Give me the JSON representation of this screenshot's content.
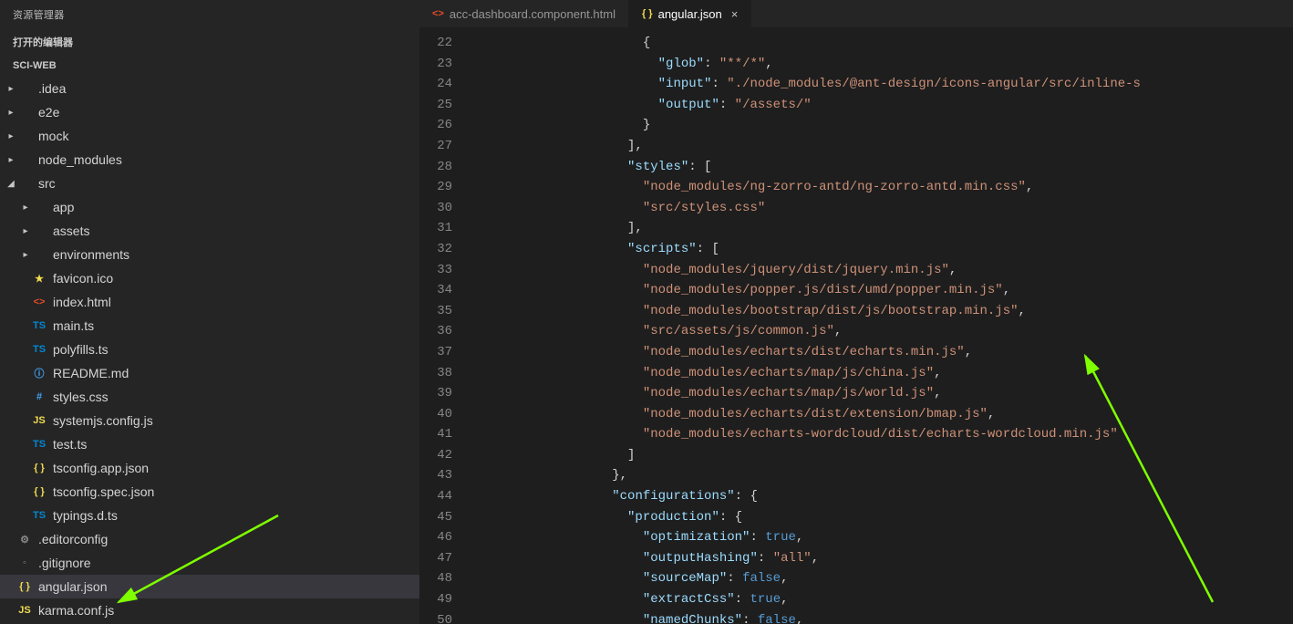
{
  "sidebar": {
    "title": "资源管理器",
    "open_editors": "打开的编辑器",
    "project": "SCI-WEB",
    "items": [
      {
        "label": ".idea",
        "kind": "folder",
        "expanded": false,
        "depth": 0
      },
      {
        "label": "e2e",
        "kind": "folder",
        "expanded": false,
        "depth": 0
      },
      {
        "label": "mock",
        "kind": "folder",
        "expanded": false,
        "depth": 0
      },
      {
        "label": "node_modules",
        "kind": "folder",
        "expanded": false,
        "depth": 0
      },
      {
        "label": "src",
        "kind": "folder",
        "expanded": true,
        "depth": 0
      },
      {
        "label": "app",
        "kind": "folder",
        "expanded": false,
        "depth": 1
      },
      {
        "label": "assets",
        "kind": "folder",
        "expanded": false,
        "depth": 1
      },
      {
        "label": "environments",
        "kind": "folder",
        "expanded": false,
        "depth": 1
      },
      {
        "label": "favicon.ico",
        "kind": "star",
        "depth": 1
      },
      {
        "label": "index.html",
        "kind": "html",
        "depth": 1
      },
      {
        "label": "main.ts",
        "kind": "ts",
        "depth": 1
      },
      {
        "label": "polyfills.ts",
        "kind": "ts",
        "depth": 1
      },
      {
        "label": "README.md",
        "kind": "md",
        "depth": 1
      },
      {
        "label": "styles.css",
        "kind": "css",
        "depth": 1
      },
      {
        "label": "systemjs.config.js",
        "kind": "js",
        "depth": 1
      },
      {
        "label": "test.ts",
        "kind": "ts",
        "depth": 1
      },
      {
        "label": "tsconfig.app.json",
        "kind": "json",
        "depth": 1
      },
      {
        "label": "tsconfig.spec.json",
        "kind": "json",
        "depth": 1
      },
      {
        "label": "typings.d.ts",
        "kind": "ts",
        "depth": 1
      },
      {
        "label": ".editorconfig",
        "kind": "gear",
        "depth": 0
      },
      {
        "label": ".gitignore",
        "kind": "dot",
        "depth": 0
      },
      {
        "label": "angular.json",
        "kind": "json",
        "depth": 0,
        "active": true
      },
      {
        "label": "karma.conf.js",
        "kind": "js",
        "depth": 0
      }
    ]
  },
  "tabs": [
    {
      "label": "acc-dashboard.component.html",
      "icon": "html",
      "active": false
    },
    {
      "label": "angular.json",
      "icon": "json",
      "active": true
    }
  ],
  "editor": {
    "first_line": 22,
    "lines": [
      [
        {
          "t": "punc",
          "v": "              {"
        }
      ],
      [
        {
          "t": "punc",
          "v": "                "
        },
        {
          "t": "key",
          "v": "\"glob\""
        },
        {
          "t": "punc",
          "v": ": "
        },
        {
          "t": "str",
          "v": "\"**/*\""
        },
        {
          "t": "punc",
          "v": ","
        }
      ],
      [
        {
          "t": "punc",
          "v": "                "
        },
        {
          "t": "key",
          "v": "\"input\""
        },
        {
          "t": "punc",
          "v": ": "
        },
        {
          "t": "str",
          "v": "\"./node_modules/@ant-design/icons-angular/src/inline-s"
        }
      ],
      [
        {
          "t": "punc",
          "v": "                "
        },
        {
          "t": "key",
          "v": "\"output\""
        },
        {
          "t": "punc",
          "v": ": "
        },
        {
          "t": "str",
          "v": "\"/assets/\""
        }
      ],
      [
        {
          "t": "punc",
          "v": "              }"
        }
      ],
      [
        {
          "t": "punc",
          "v": "            ],"
        }
      ],
      [
        {
          "t": "punc",
          "v": "            "
        },
        {
          "t": "key",
          "v": "\"styles\""
        },
        {
          "t": "punc",
          "v": ": ["
        }
      ],
      [
        {
          "t": "punc",
          "v": "              "
        },
        {
          "t": "str",
          "v": "\"node_modules/ng-zorro-antd/ng-zorro-antd.min.css\""
        },
        {
          "t": "punc",
          "v": ","
        }
      ],
      [
        {
          "t": "punc",
          "v": "              "
        },
        {
          "t": "str",
          "v": "\"src/styles.css\""
        }
      ],
      [
        {
          "t": "punc",
          "v": "            ],"
        }
      ],
      [
        {
          "t": "punc",
          "v": "            "
        },
        {
          "t": "key",
          "v": "\"scripts\""
        },
        {
          "t": "punc",
          "v": ": ["
        }
      ],
      [
        {
          "t": "punc",
          "v": "              "
        },
        {
          "t": "str",
          "v": "\"node_modules/jquery/dist/jquery.min.js\""
        },
        {
          "t": "punc",
          "v": ","
        }
      ],
      [
        {
          "t": "punc",
          "v": "              "
        },
        {
          "t": "str",
          "v": "\"node_modules/popper.js/dist/umd/popper.min.js\""
        },
        {
          "t": "punc",
          "v": ","
        }
      ],
      [
        {
          "t": "punc",
          "v": "              "
        },
        {
          "t": "str",
          "v": "\"node_modules/bootstrap/dist/js/bootstrap.min.js\""
        },
        {
          "t": "punc",
          "v": ","
        }
      ],
      [
        {
          "t": "punc",
          "v": "              "
        },
        {
          "t": "str",
          "v": "\"src/assets/js/common.js\""
        },
        {
          "t": "punc",
          "v": ","
        }
      ],
      [
        {
          "t": "punc",
          "v": "              "
        },
        {
          "t": "str",
          "v": "\"node_modules/echarts/dist/echarts.min.js\""
        },
        {
          "t": "punc",
          "v": ","
        }
      ],
      [
        {
          "t": "punc",
          "v": "              "
        },
        {
          "t": "str",
          "v": "\"node_modules/echarts/map/js/china.js\""
        },
        {
          "t": "punc",
          "v": ","
        }
      ],
      [
        {
          "t": "punc",
          "v": "              "
        },
        {
          "t": "str",
          "v": "\"node_modules/echarts/map/js/world.js\""
        },
        {
          "t": "punc",
          "v": ","
        }
      ],
      [
        {
          "t": "punc",
          "v": "              "
        },
        {
          "t": "str",
          "v": "\"node_modules/echarts/dist/extension/bmap.js\""
        },
        {
          "t": "punc",
          "v": ","
        }
      ],
      [
        {
          "t": "punc",
          "v": "              "
        },
        {
          "t": "str",
          "v": "\"node_modules/echarts-wordcloud/dist/echarts-wordcloud.min.js\""
        }
      ],
      [
        {
          "t": "punc",
          "v": "            ]"
        }
      ],
      [
        {
          "t": "punc",
          "v": "          },"
        }
      ],
      [
        {
          "t": "punc",
          "v": "          "
        },
        {
          "t": "key",
          "v": "\"configurations\""
        },
        {
          "t": "punc",
          "v": ": {"
        }
      ],
      [
        {
          "t": "punc",
          "v": "            "
        },
        {
          "t": "key",
          "v": "\"production\""
        },
        {
          "t": "punc",
          "v": ": {"
        }
      ],
      [
        {
          "t": "punc",
          "v": "              "
        },
        {
          "t": "key",
          "v": "\"optimization\""
        },
        {
          "t": "punc",
          "v": ": "
        },
        {
          "t": "const",
          "v": "true"
        },
        {
          "t": "punc",
          "v": ","
        }
      ],
      [
        {
          "t": "punc",
          "v": "              "
        },
        {
          "t": "key",
          "v": "\"outputHashing\""
        },
        {
          "t": "punc",
          "v": ": "
        },
        {
          "t": "str",
          "v": "\"all\""
        },
        {
          "t": "punc",
          "v": ","
        }
      ],
      [
        {
          "t": "punc",
          "v": "              "
        },
        {
          "t": "key",
          "v": "\"sourceMap\""
        },
        {
          "t": "punc",
          "v": ": "
        },
        {
          "t": "const",
          "v": "false"
        },
        {
          "t": "punc",
          "v": ","
        }
      ],
      [
        {
          "t": "punc",
          "v": "              "
        },
        {
          "t": "key",
          "v": "\"extractCss\""
        },
        {
          "t": "punc",
          "v": ": "
        },
        {
          "t": "const",
          "v": "true"
        },
        {
          "t": "punc",
          "v": ","
        }
      ],
      [
        {
          "t": "punc",
          "v": "              "
        },
        {
          "t": "key",
          "v": "\"namedChunks\""
        },
        {
          "t": "punc",
          "v": ": "
        },
        {
          "t": "const",
          "v": "false"
        },
        {
          "t": "punc",
          "v": ","
        }
      ]
    ]
  },
  "icons": {
    "folder": "",
    "ts": "TS",
    "js": "JS",
    "json": "{ }",
    "html": "<>",
    "css": "#",
    "md": "ⓘ",
    "star": "★",
    "gear": "⚙",
    "dot": "◦"
  }
}
